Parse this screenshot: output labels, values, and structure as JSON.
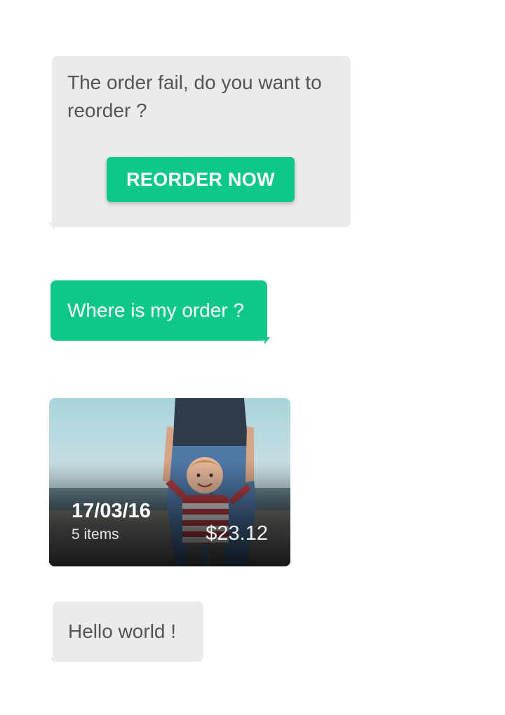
{
  "colors": {
    "accent": "#0ec78a",
    "bubble_gray": "#ebebeb",
    "text_gray": "#555555"
  },
  "messages": {
    "reorder_prompt": "The order fail, do you want to reorder ?",
    "reorder_button": "REORDER NOW",
    "user_question": "Where is my order ?",
    "hello": "Hello world !"
  },
  "order_card": {
    "date": "17/03/16",
    "items": "5 items",
    "price": "$23.12",
    "image": "photo of a child holding an adult's hands at the beach"
  }
}
